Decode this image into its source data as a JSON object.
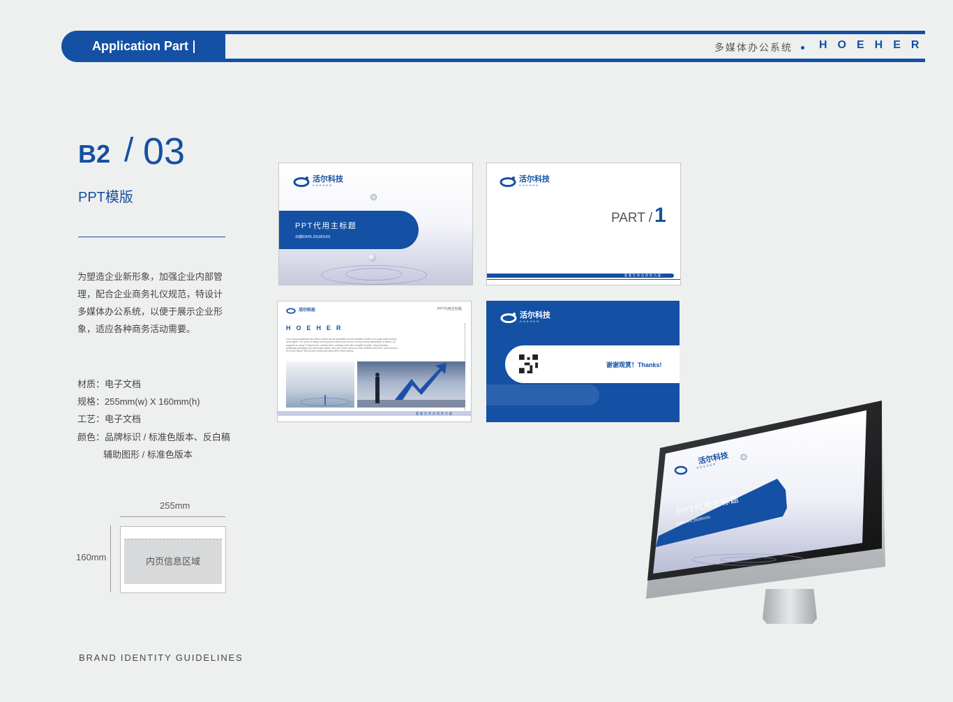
{
  "header": {
    "title": "Application Part",
    "system": "多媒体办公系统",
    "brand": "HOEHER"
  },
  "section": {
    "code": "B2",
    "slash": "/",
    "number": "03",
    "title": "PPT模版",
    "description": "为塑造企业新形象，加强企业内部管理，配合企业商务礼仪规范，特设计多媒体办公系统，以便于展示企业形象，适应各种商务活动需要。",
    "specs": [
      "材质：电子文档",
      "规格：255mm(w) X 160mm(h)",
      "工艺：电子文档",
      "颜色：品牌标识 / 标准色版本、反白稿",
      "辅助图形 / 标准色版本"
    ]
  },
  "dimension": {
    "width": "255mm",
    "height": "160mm",
    "area_label": "内页信息区域"
  },
  "footer": "BRAND IDENTITY GUIDELINES",
  "logo": {
    "cn": "活尔科技",
    "en": "HOEHER"
  },
  "slides": {
    "cover": {
      "title": "PPT代用主标题",
      "date": "日期/DATE.2018/01/01"
    },
    "section": {
      "part": "PART /",
      "number": "1",
      "slogan": "看看生命自然的力量"
    },
    "content": {
      "brand": "HOEHER",
      "header": "PPT代用主标题",
      "body": "It is a long established fact that a reader will be distracted by the readable content of a page when looking at its layout. The point of using Lorem Ipsum is that it has a more-or-less normal distribution of letters, as opposed to using 'Content here, content here', making it look like readable English. Many desktop publishing packages and web page editors now use Lorem Ipsum as their default model text, and a search for 'lorem ipsum' will uncover many web sites still in their infancy.",
      "slogan": "看看生命自然的力量"
    },
    "end": {
      "thanks": "谢谢观赏！Thanks!"
    }
  },
  "monitor": {
    "title": "PPT代用主标题",
    "date": "日期/DATE.2018/01/01"
  },
  "colors": {
    "brand_blue": "#1450a3",
    "background": "#eef0ef"
  }
}
